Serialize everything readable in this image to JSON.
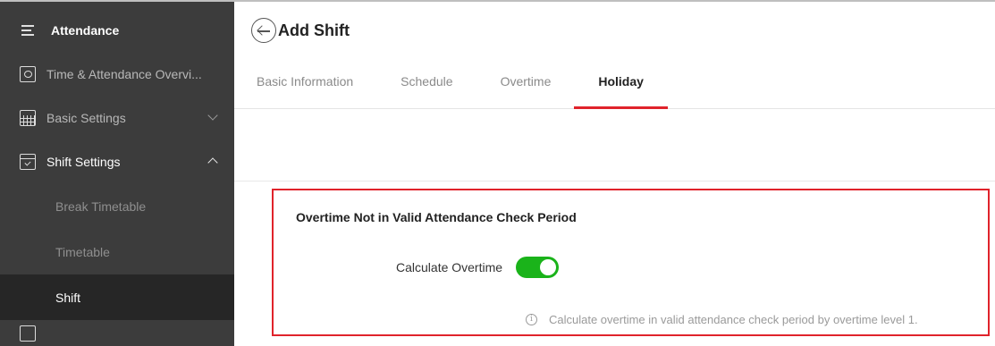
{
  "sidebar": {
    "title": "Attendance",
    "items": [
      {
        "label": "Time & Attendance Overvi...",
        "icon": "monitor-icon"
      },
      {
        "label": "Basic Settings",
        "icon": "grid-settings-icon"
      },
      {
        "label": "Shift Settings",
        "icon": "calendar-check-icon"
      }
    ],
    "sub_items": [
      {
        "label": "Break Timetable"
      },
      {
        "label": "Timetable"
      },
      {
        "label": "Shift",
        "active": true
      }
    ]
  },
  "header": {
    "title": "Add Shift"
  },
  "tabs": [
    {
      "label": "Basic Information"
    },
    {
      "label": "Schedule"
    },
    {
      "label": "Overtime"
    },
    {
      "label": "Holiday",
      "active": true
    }
  ],
  "section": {
    "title": "Overtime Not in Valid Attendance Check Period",
    "toggle_label": "Calculate Overtime",
    "toggle_on": true,
    "hint": "Calculate overtime in valid attendance check period by overtime level 1."
  },
  "colors": {
    "accent": "#e0232b",
    "toggle_on": "#1ab31a",
    "sidebar_bg": "#3c3c3c"
  }
}
